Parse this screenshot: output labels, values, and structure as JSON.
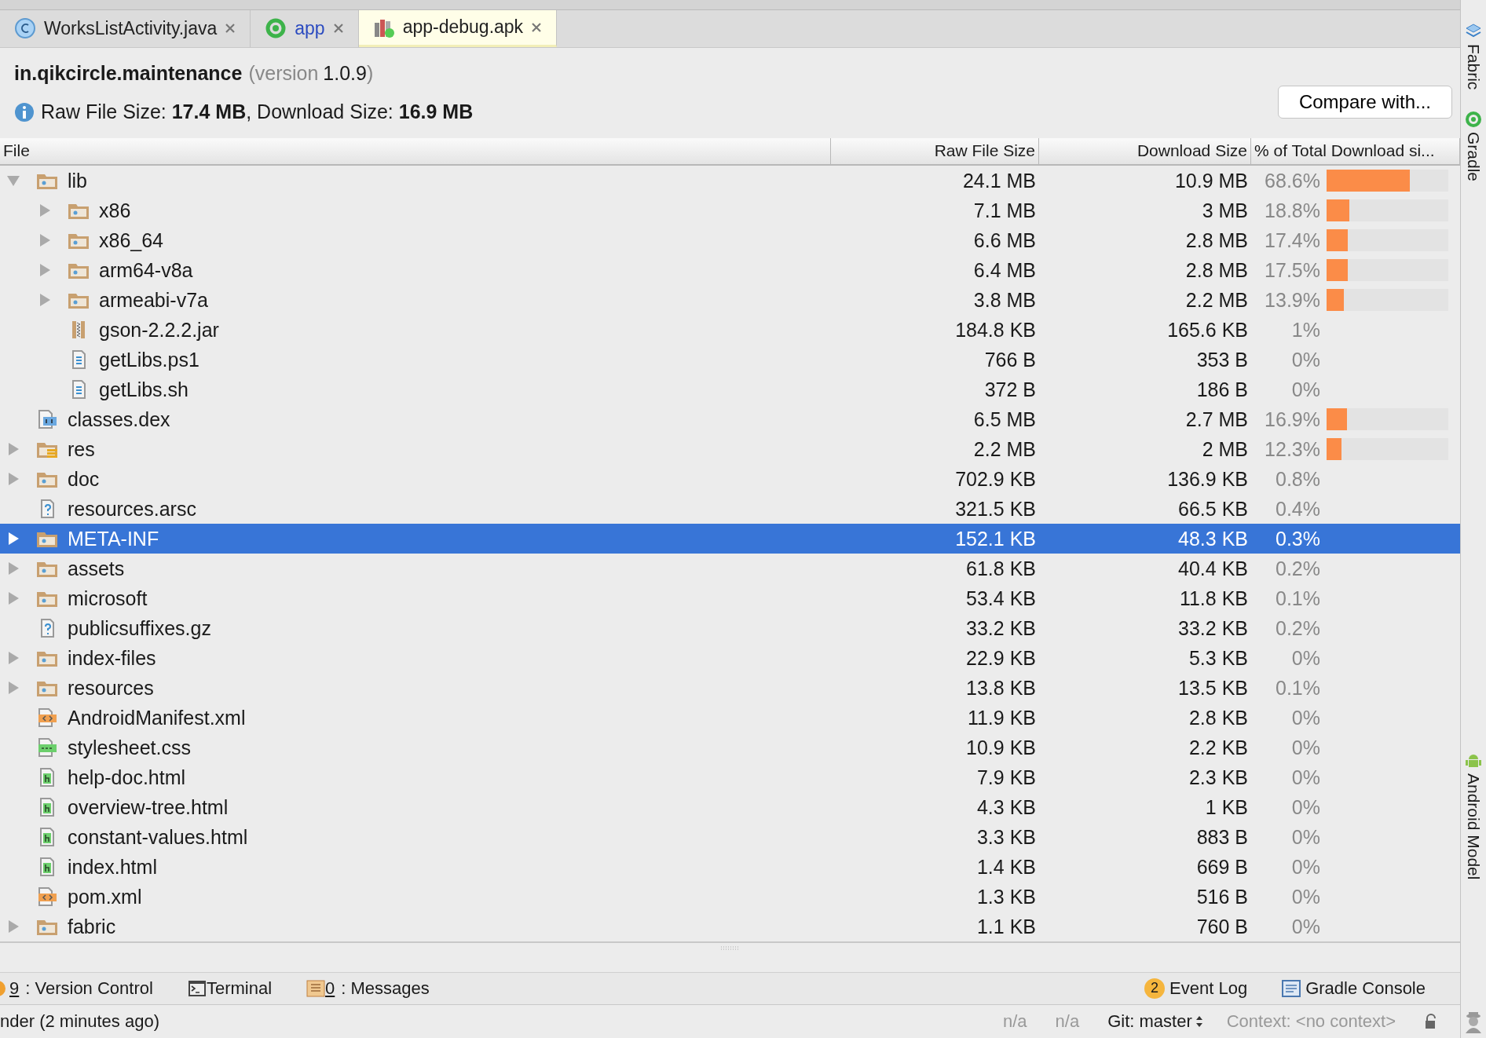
{
  "tabs": [
    {
      "kind": "java",
      "label": "WorksListActivity.java",
      "selected": false
    },
    {
      "kind": "module",
      "label": "app",
      "selected": false
    },
    {
      "kind": "apk",
      "label": "app-debug.apk",
      "selected": true
    }
  ],
  "header": {
    "package": "in.qikcircle.maintenance",
    "version_open": "(version",
    "version": "1.0.9",
    "version_close": ")",
    "info": "Raw File Size: **17.4 MB**, Download Size: **16.9 MB**",
    "compare_button": "Compare with..."
  },
  "table": {
    "columns": [
      "File",
      "Raw File Size",
      "Download Size",
      "% of Total Download si..."
    ],
    "tree": [
      {
        "kind": "folder",
        "name": "lib",
        "raw": "24.1 MB",
        "download": "10.9 MB",
        "percent": "68.6%",
        "level": 0.686,
        "expanded": true,
        "selected": false,
        "children": [
          {
            "kind": "folder",
            "name": "x86",
            "raw": "7.1 MB",
            "download": "3 MB",
            "percent": "18.8%",
            "level": 0.188,
            "expanded": false,
            "selected": false
          },
          {
            "kind": "folder",
            "name": "x86_64",
            "raw": "6.6 MB",
            "download": "2.8 MB",
            "percent": "17.4%",
            "level": 0.174,
            "expanded": false,
            "selected": false
          },
          {
            "kind": "folder",
            "name": "arm64-v8a",
            "raw": "6.4 MB",
            "download": "2.8 MB",
            "percent": "17.5%",
            "level": 0.175,
            "expanded": false,
            "selected": false
          },
          {
            "kind": "folder",
            "name": "armeabi-v7a",
            "raw": "3.8 MB",
            "download": "2.2 MB",
            "percent": "13.9%",
            "level": 0.139,
            "expanded": false,
            "selected": false
          },
          {
            "kind": "jar",
            "name": "gson-2.2.2.jar",
            "raw": "184.8 KB",
            "download": "165.6 KB",
            "percent": "1%",
            "selected": false
          },
          {
            "kind": "text",
            "name": "getLibs.ps1",
            "raw": "766 B",
            "download": "353 B",
            "percent": "0%",
            "selected": false
          },
          {
            "kind": "text",
            "name": "getLibs.sh",
            "raw": "372 B",
            "download": "186 B",
            "percent": "0%",
            "selected": false
          }
        ]
      },
      {
        "kind": "dex",
        "name": "classes.dex",
        "raw": "6.5 MB",
        "download": "2.7 MB",
        "percent": "16.9%",
        "level": 0.169,
        "selected": false
      },
      {
        "kind": "res",
        "name": "res",
        "raw": "2.2 MB",
        "download": "2 MB",
        "percent": "12.3%",
        "level": 0.123,
        "expanded": false,
        "selected": false
      },
      {
        "kind": "folder",
        "name": "doc",
        "raw": "702.9 KB",
        "download": "136.9 KB",
        "percent": "0.8%",
        "expanded": false,
        "selected": false
      },
      {
        "kind": "unknown",
        "name": "resources.arsc",
        "raw": "321.5 KB",
        "download": "66.5 KB",
        "percent": "0.4%",
        "selected": false
      },
      {
        "kind": "folder",
        "name": "META-INF",
        "raw": "152.1 KB",
        "download": "48.3 KB",
        "percent": "0.3%",
        "expanded": false,
        "selected": true
      },
      {
        "kind": "folder",
        "name": "assets",
        "raw": "61.8 KB",
        "download": "40.4 KB",
        "percent": "0.2%",
        "expanded": false,
        "selected": false
      },
      {
        "kind": "folder",
        "name": "microsoft",
        "raw": "53.4 KB",
        "download": "11.8 KB",
        "percent": "0.1%",
        "expanded": false,
        "selected": false
      },
      {
        "kind": "unknown",
        "name": "publicsuffixes.gz",
        "raw": "33.2 KB",
        "download": "33.2 KB",
        "percent": "0.2%",
        "selected": false
      },
      {
        "kind": "folder",
        "name": "index-files",
        "raw": "22.9 KB",
        "download": "5.3 KB",
        "percent": "0%",
        "expanded": false,
        "selected": false
      },
      {
        "kind": "folder",
        "name": "resources",
        "raw": "13.8 KB",
        "download": "13.5 KB",
        "percent": "0.1%",
        "expanded": false,
        "selected": false
      },
      {
        "kind": "xml",
        "name": "AndroidManifest.xml",
        "raw": "11.9 KB",
        "download": "2.8 KB",
        "percent": "0%",
        "selected": false
      },
      {
        "kind": "css",
        "name": "stylesheet.css",
        "raw": "10.9 KB",
        "download": "2.2 KB",
        "percent": "0%",
        "selected": false
      },
      {
        "kind": "html",
        "name": "help-doc.html",
        "raw": "7.9 KB",
        "download": "2.3 KB",
        "percent": "0%",
        "selected": false
      },
      {
        "kind": "html",
        "name": "overview-tree.html",
        "raw": "4.3 KB",
        "download": "1 KB",
        "percent": "0%",
        "selected": false
      },
      {
        "kind": "html",
        "name": "constant-values.html",
        "raw": "3.3 KB",
        "download": "883 B",
        "percent": "0%",
        "selected": false
      },
      {
        "kind": "html",
        "name": "index.html",
        "raw": "1.4 KB",
        "download": "669 B",
        "percent": "0%",
        "selected": false
      },
      {
        "kind": "xml",
        "name": "pom.xml",
        "raw": "1.3 KB",
        "download": "516 B",
        "percent": "0%",
        "selected": false
      },
      {
        "kind": "folder",
        "name": "fabric",
        "raw": "1.1 KB",
        "download": "760 B",
        "percent": "0%",
        "expanded": false,
        "selected": false
      }
    ]
  },
  "tool_windows_left": [
    {
      "kind": "vcs",
      "mnemonic": "9",
      "label": ": Version Control"
    },
    {
      "kind": "terminal",
      "label": "Terminal"
    },
    {
      "kind": "messages",
      "mnemonic": "0",
      "label": ": Messages"
    }
  ],
  "tool_windows_right": [
    {
      "kind": "eventlog",
      "badge": "2",
      "label": "Event Log"
    },
    {
      "kind": "gradle",
      "label": "Gradle Console"
    }
  ],
  "status_bar": {
    "message": "nder (2 minutes ago)",
    "items": [
      "n/a",
      "n/a"
    ],
    "git": "Git: master",
    "context": "Context: <no context>"
  },
  "side_tools": [
    {
      "kind": "fabric",
      "label": "Fabric"
    },
    {
      "kind": "gradle",
      "label": "Gradle"
    },
    {
      "kind": "android",
      "label": "Android Model"
    }
  ]
}
